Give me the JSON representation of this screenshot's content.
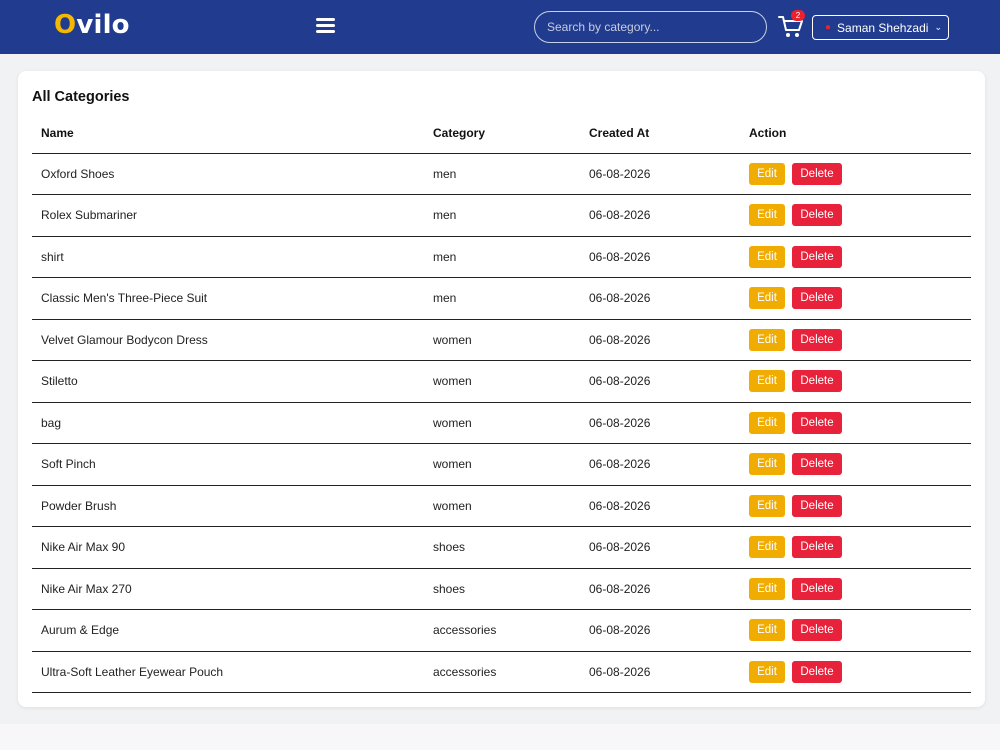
{
  "brand": {
    "first_letter": "O",
    "rest": "vilo"
  },
  "search": {
    "placeholder": "Search by category..."
  },
  "cart": {
    "count": "2"
  },
  "user": {
    "name": "Saman Shehzadi"
  },
  "page": {
    "title": "All Categories",
    "columns": [
      "Name",
      "Category",
      "Created At",
      "Action"
    ],
    "rows": [
      {
        "name": "Oxford Shoes",
        "category": "men",
        "created_at": "06-08-2026"
      },
      {
        "name": "Rolex Submariner",
        "category": "men",
        "created_at": "06-08-2026"
      },
      {
        "name": "shirt",
        "category": "men",
        "created_at": "06-08-2026"
      },
      {
        "name": "Classic Men's Three-Piece Suit",
        "category": "men",
        "created_at": "06-08-2026"
      },
      {
        "name": "Velvet Glamour Bodycon Dress",
        "category": "women",
        "created_at": "06-08-2026"
      },
      {
        "name": "Stiletto",
        "category": "women",
        "created_at": "06-08-2026"
      },
      {
        "name": "bag",
        "category": "women",
        "created_at": "06-08-2026"
      },
      {
        "name": "Soft Pinch",
        "category": "women",
        "created_at": "06-08-2026"
      },
      {
        "name": "Powder Brush",
        "category": "women",
        "created_at": "06-08-2026"
      },
      {
        "name": "Nike Air Max 90",
        "category": "shoes",
        "created_at": "06-08-2026"
      },
      {
        "name": "Nike Air Max 270",
        "category": "shoes",
        "created_at": "06-08-2026"
      },
      {
        "name": "Aurum & Edge",
        "category": "accessories",
        "created_at": "06-08-2026"
      },
      {
        "name": "Ultra-Soft Leather Eyewear Pouch",
        "category": "accessories",
        "created_at": "06-08-2026"
      }
    ],
    "edit_label": "Edit",
    "delete_label": "Delete"
  },
  "colors": {
    "navbar": "#213c8e",
    "accent": "#f5b800",
    "edit": "#f0ac00",
    "delete": "#e8223a",
    "badge": "#e8222e"
  },
  "icons": {
    "menu": "hamburger-icon",
    "cart": "cart-icon",
    "user": "user-icon",
    "dropdown": "chevron-down-icon"
  }
}
